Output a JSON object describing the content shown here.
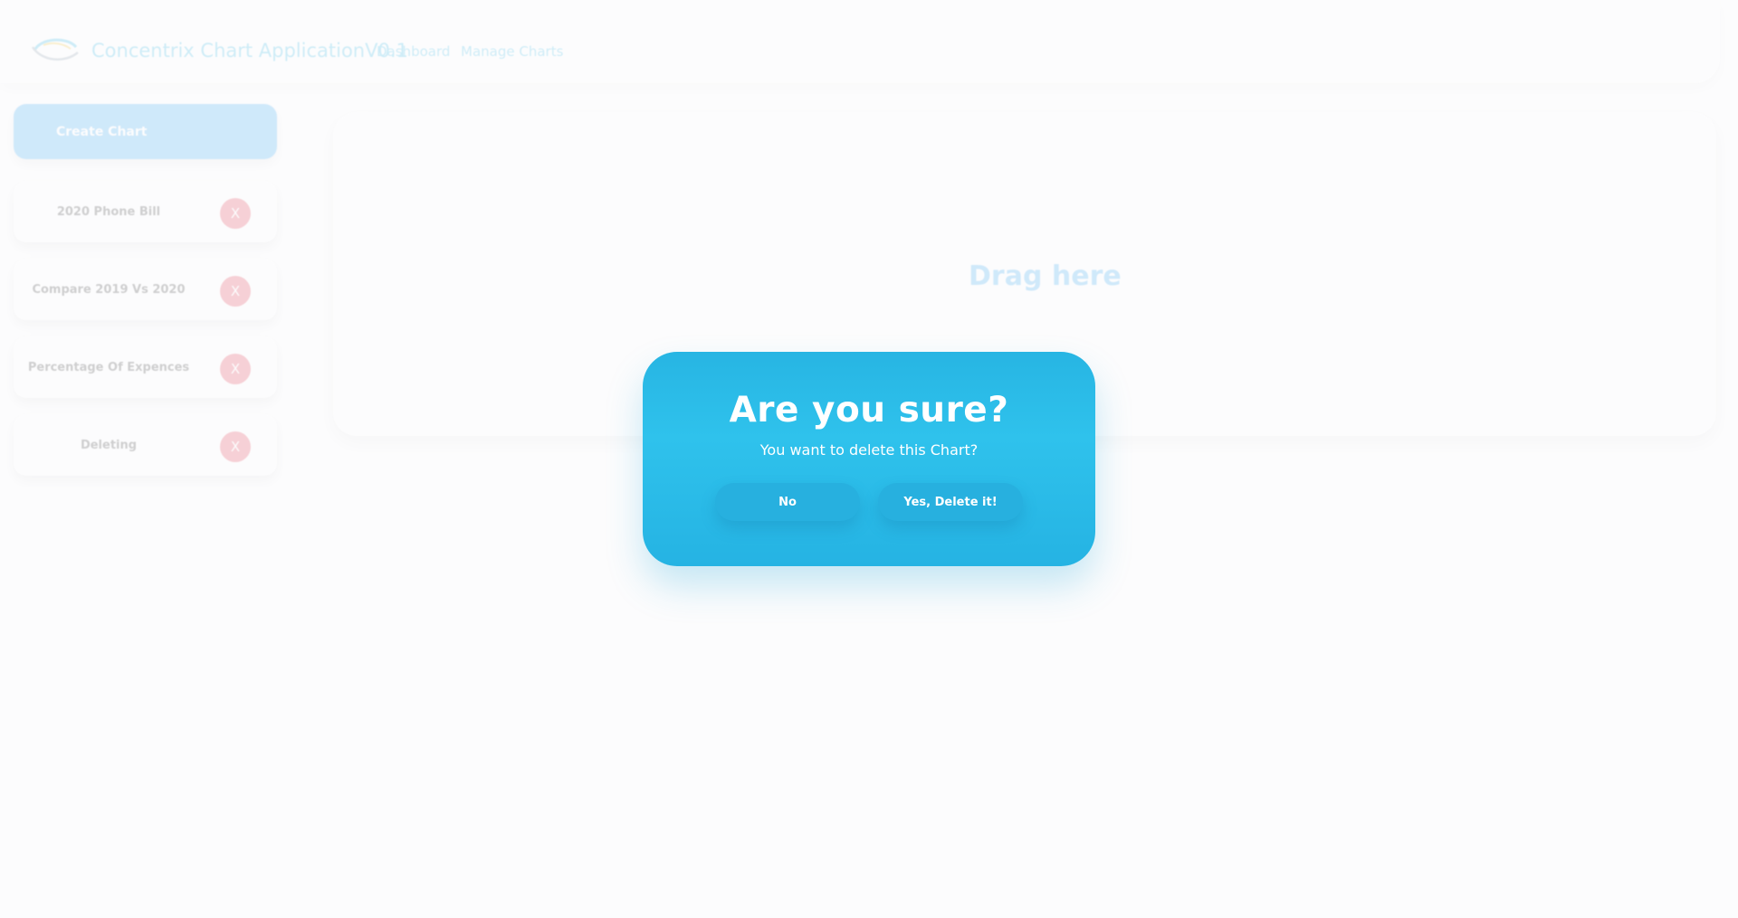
{
  "header": {
    "app_title": "Concentrix Chart ApplicationV0.1",
    "nav": {
      "dashboard": "Dashboard",
      "manage_charts": "Manage Charts"
    }
  },
  "sidebar": {
    "create_button": "Create Chart",
    "charts": [
      {
        "name": "2020 Phone Bill",
        "delete_label": "X"
      },
      {
        "name": "Compare 2019 Vs 2020",
        "delete_label": "X"
      },
      {
        "name": "Percentage Of Expences",
        "delete_label": "X"
      },
      {
        "name": "Deleting",
        "delete_label": "X"
      }
    ]
  },
  "main": {
    "drop_text": "Drag here"
  },
  "modal": {
    "title": "Are you sure?",
    "message": "You want to delete this Chart?",
    "cancel_label": "No",
    "confirm_label": "Yes, Delete it!"
  },
  "colors": {
    "accent": "#2fb7e5",
    "modal_bg": "#27b5e3",
    "create_button": "#36a7f3",
    "delete_button": "#e53950"
  },
  "icons": {
    "logo": "concentrix-swoosh-logo",
    "delete": "x-mark"
  }
}
